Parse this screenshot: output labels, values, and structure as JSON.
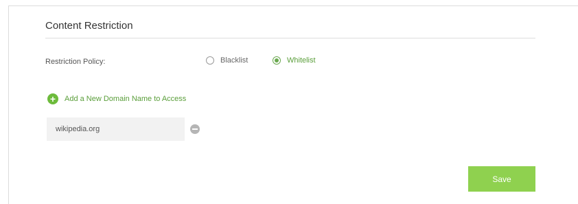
{
  "section": {
    "title": "Content Restriction"
  },
  "policy": {
    "label": "Restriction Policy:",
    "options": [
      {
        "label": "Blacklist",
        "selected": false
      },
      {
        "label": "Whitelist",
        "selected": true
      }
    ]
  },
  "add_domain": {
    "label": "Add a New Domain Name to Access",
    "icon": "plus-circle-icon"
  },
  "domain_entry": {
    "value": "wikipedia.org",
    "remove_icon": "minus-circle-icon"
  },
  "actions": {
    "save_label": "Save"
  },
  "colors": {
    "accent": "#6dbb3c",
    "save_button": "#8fd14f",
    "input_background": "#f2f2f2"
  }
}
